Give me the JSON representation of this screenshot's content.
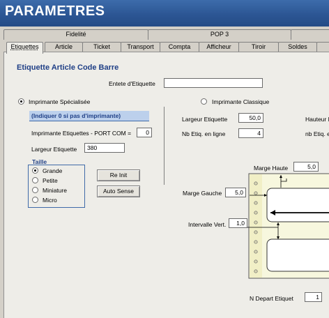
{
  "window": {
    "title": "PARAMETRES"
  },
  "tabs_row1": [
    "Fidelité",
    "POP 3"
  ],
  "tabs_row2": [
    "Etiquettes",
    "Article",
    "Ticket",
    "Transport",
    "Compta",
    "Afficheur",
    "Tiroir",
    "Soldes"
  ],
  "active_tab": "Etiquettes",
  "section": {
    "title": "Etiquette Article Code Barre"
  },
  "entete": {
    "label": "Entete d'Etiquette",
    "value": ""
  },
  "specialisee": {
    "label": "Imprimante Spécialisée",
    "selected": true,
    "hint": "(Indiquer 0 si pas d'imprimante)",
    "port_label": "Imprimante Etiquettes - PORT COM =",
    "port_value": "0",
    "largeur_label": "Largeur Etiquette",
    "largeur_value": "380",
    "taille": {
      "label": "Taille",
      "options": [
        "Grande",
        "Petite",
        "Miniature",
        "Micro"
      ],
      "selected": "Grande"
    },
    "reinit_label": "Re Init",
    "autosense_label": "Auto Sense"
  },
  "classique": {
    "label": "Imprimante Classique",
    "selected": false,
    "largeur_label": "Largeur Etiquette",
    "largeur_value": "50,0",
    "hauteur_label": "Hauteur E",
    "nb_ligne_label": "Nb Etiq. en ligne",
    "nb_ligne_value": "4",
    "nb_col_label": "nb Etiq. e",
    "marge_haute_label": "Marge Haute",
    "marge_haute_value": "5,0",
    "marge_gauche_label": "Marge Gauche",
    "marge_gauche_value": "5,0",
    "intervalle_label": "Intervalle Vert.",
    "intervalle_value": "1,0",
    "depart_label": "N Depart Etiquet",
    "depart_value": "1"
  },
  "colors": {
    "title_bar": "#2c5694",
    "hint_band": "#bcd0ec",
    "accent": "#1f3f86"
  }
}
